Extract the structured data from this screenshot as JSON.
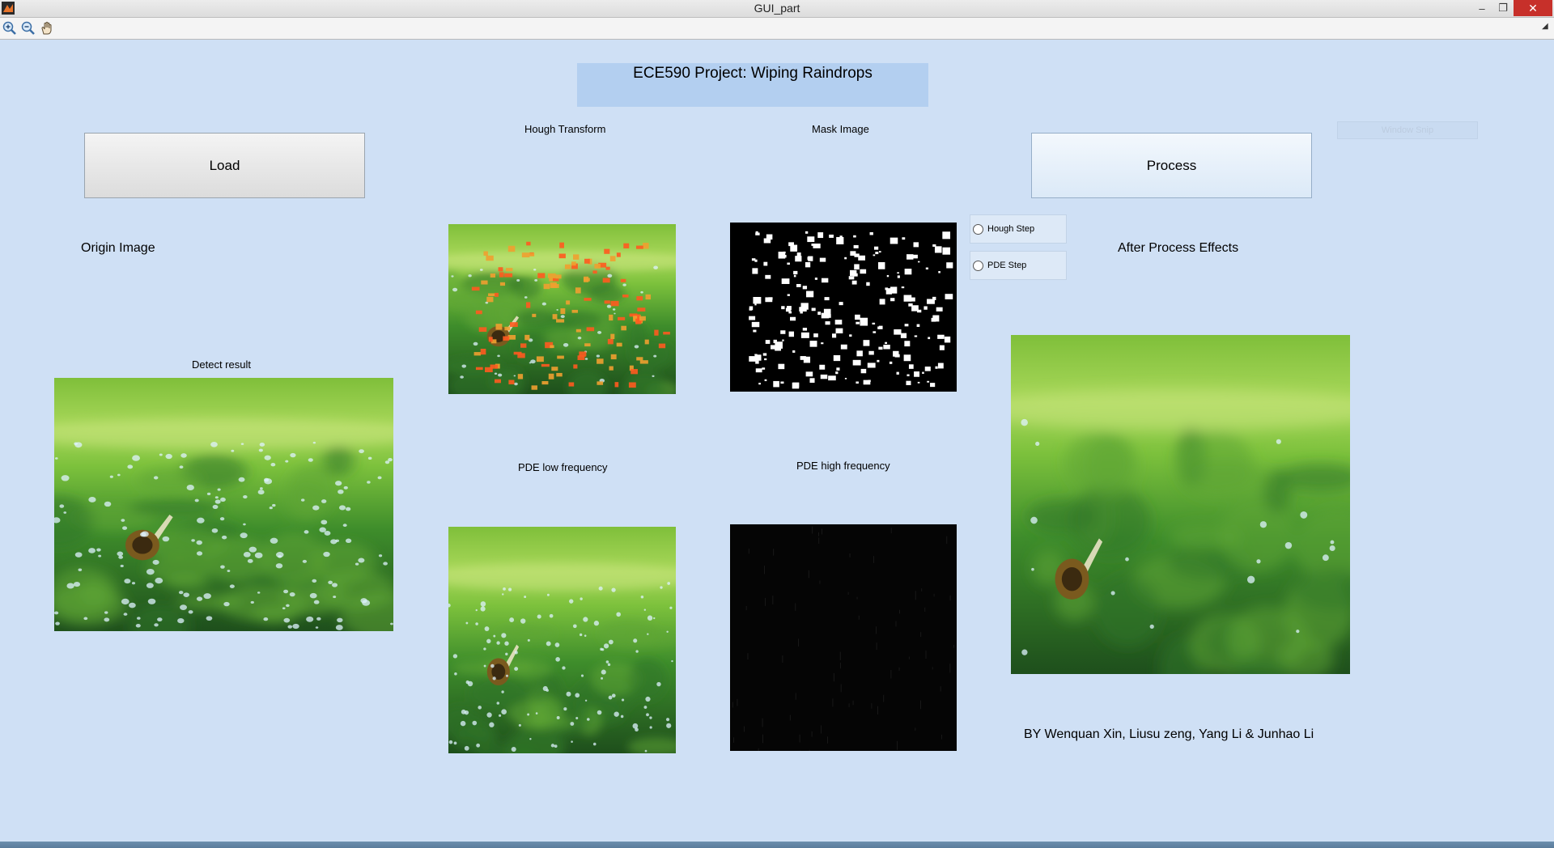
{
  "window": {
    "title": "GUI_part"
  },
  "window_controls": {
    "minimize": "–",
    "maximize": "❐",
    "close": "✕"
  },
  "toolbar": {
    "icons": [
      "zoom-in-icon",
      "zoom-out-icon",
      "pan-hand-icon"
    ],
    "overflow": "◢"
  },
  "header": {
    "title": "ECE590 Project: Wiping Raindrops"
  },
  "buttons": {
    "load": "Load",
    "process": "Process",
    "snip": "Window Snip"
  },
  "labels": {
    "hough": "Hough Transform",
    "mask": "Mask Image",
    "origin": "Origin Image",
    "detect": "Detect result",
    "pde_low": "PDE low frequency",
    "pde_high": "PDE high frequency",
    "after": "After Process Effects",
    "authors": "BY Wenquan Xin, Liusu zeng, Yang Li & Junhao Li"
  },
  "radios": {
    "hough_step": "Hough Step",
    "pde_step": "PDE Step"
  },
  "colors": {
    "background": "#cfe0f5",
    "title_panel": "#b3cff0",
    "close": "#c7302a"
  }
}
